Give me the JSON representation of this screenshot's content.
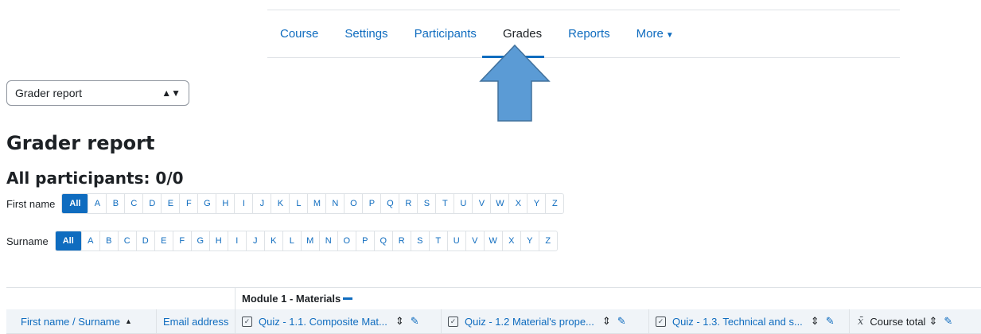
{
  "nav": {
    "items": [
      {
        "label": "Course"
      },
      {
        "label": "Settings"
      },
      {
        "label": "Participants"
      },
      {
        "label": "Grades"
      },
      {
        "label": "Reports"
      },
      {
        "label": "More"
      }
    ],
    "active": "Grades"
  },
  "report_select": {
    "value": "Grader report"
  },
  "page": {
    "title": "Grader report",
    "subtitle": "All participants: 0/0"
  },
  "initials": {
    "first_label": "First name",
    "surname_label": "Surname",
    "all_label": "All",
    "letters": [
      "A",
      "B",
      "C",
      "D",
      "E",
      "F",
      "G",
      "H",
      "I",
      "J",
      "K",
      "L",
      "M",
      "N",
      "O",
      "P",
      "Q",
      "R",
      "S",
      "T",
      "U",
      "V",
      "W",
      "X",
      "Y",
      "Z"
    ]
  },
  "table": {
    "category": "Module 1 - Materials",
    "columns": {
      "name": "First name / Surname",
      "email": "Email address",
      "quiz1": "Quiz - 1.1. Composite Mat...",
      "quiz2": "Quiz - 1.2 Material's prope...",
      "quiz3": "Quiz - 1.3. Technical and s...",
      "total": "Course total"
    }
  },
  "colors": {
    "accent": "#0f6cbf",
    "annotation_arrow": "#5b9bd5"
  }
}
